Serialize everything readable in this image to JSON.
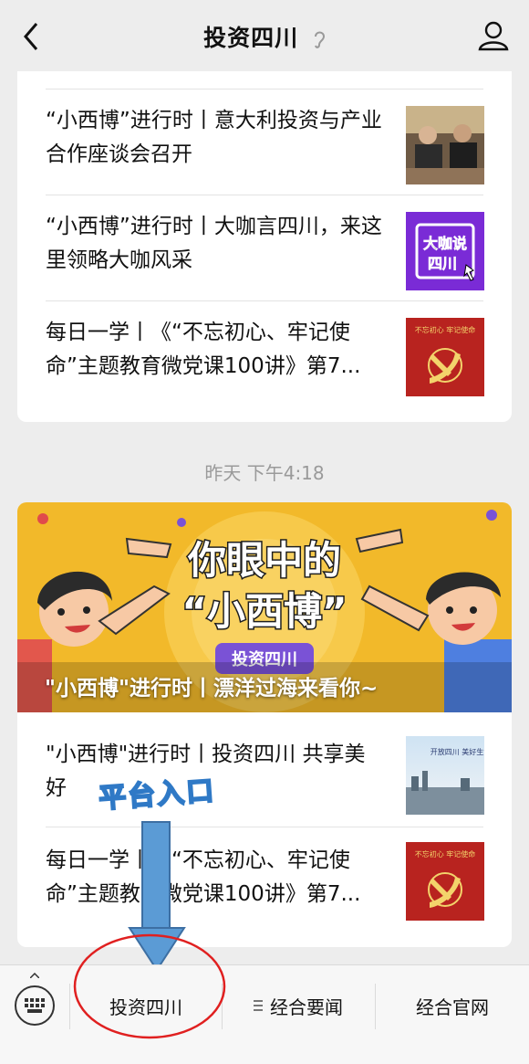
{
  "header": {
    "title": "投资四川"
  },
  "feed_top": {
    "items": [
      {
        "text": "“小西博”进行时丨意大利投资与产业合作座谈会召开"
      },
      {
        "text": "“小西博”进行时丨大咖言四川，来这里领略大咖风采",
        "thumb_text_1": "大咖说",
        "thumb_text_2": "四川"
      },
      {
        "text": "每日一学丨《“不忘初心、牢记使命”主题教育微党课100讲》第7...",
        "thumb_text": "不忘初心 牢记使命"
      }
    ]
  },
  "timestamp": "昨天 下午4:18",
  "feed_bottom": {
    "banner": {
      "headline_1": "你眼中的",
      "headline_2": "“小西博”",
      "badge": "投资四川",
      "caption": "\"小西博\"进行时丨漂洋过海来看你~"
    },
    "items": [
      {
        "text": "\"小西博\"进行时丨投资四川 共享美好",
        "thumb_text": "开放四川 美好生活"
      },
      {
        "text": "每日一学丨《“不忘初心、牢记使命”主题教育微党课100讲》第7...",
        "thumb_text": "不忘初心 牢记使命"
      }
    ]
  },
  "annotation": {
    "label": "平台入口"
  },
  "bottom_menu": {
    "items": [
      "投资四川",
      "经合要闻",
      "经合官网"
    ]
  },
  "colors": {
    "annotation_blue": "#5b9bd5",
    "annotation_red": "#e02020",
    "banner_yellow": "#f2b92a"
  }
}
